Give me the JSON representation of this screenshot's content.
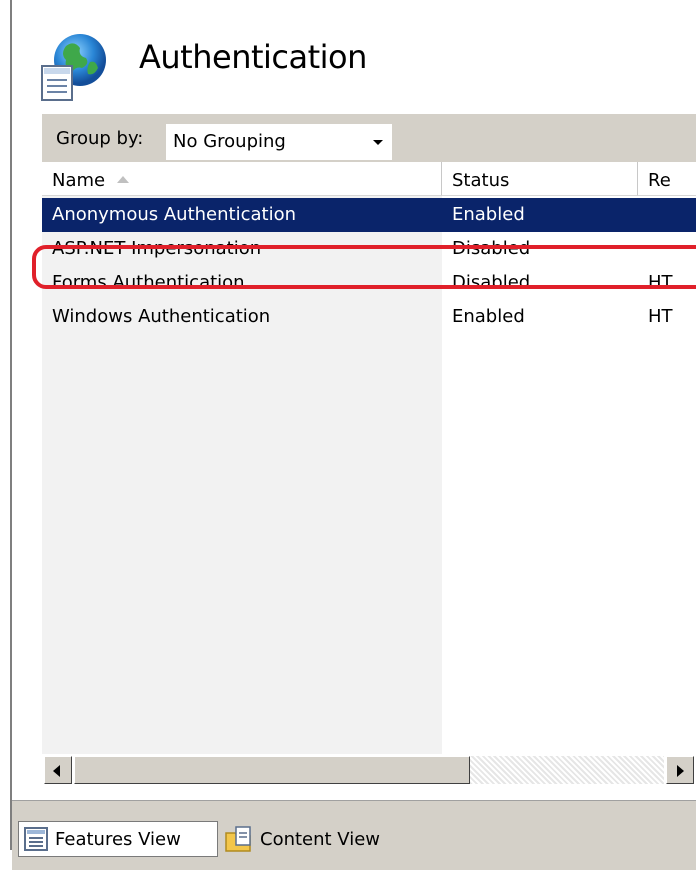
{
  "header": {
    "title": "Authentication",
    "icon": "globe-document-icon"
  },
  "toolbar": {
    "group_by_label": "Group by:",
    "group_by_value": "No Grouping"
  },
  "table": {
    "columns": [
      "Name",
      "Status",
      "Re"
    ],
    "rows": [
      {
        "name": "Anonymous Authentication",
        "status": "Enabled",
        "re": ""
      },
      {
        "name": "ASP.NET Impersonation",
        "status": "Disabled",
        "re": ""
      },
      {
        "name": "Forms Authentication",
        "status": "Disabled",
        "re": "HT"
      },
      {
        "name": "Windows Authentication",
        "status": "Enabled",
        "re": "HT"
      }
    ],
    "selected_index": 0
  },
  "bottom": {
    "features_view": "Features View",
    "content_view": "Content View"
  },
  "colors": {
    "selection": "#0a246a",
    "highlight_ring": "#e0202a",
    "panel": "#d4d0c8"
  }
}
